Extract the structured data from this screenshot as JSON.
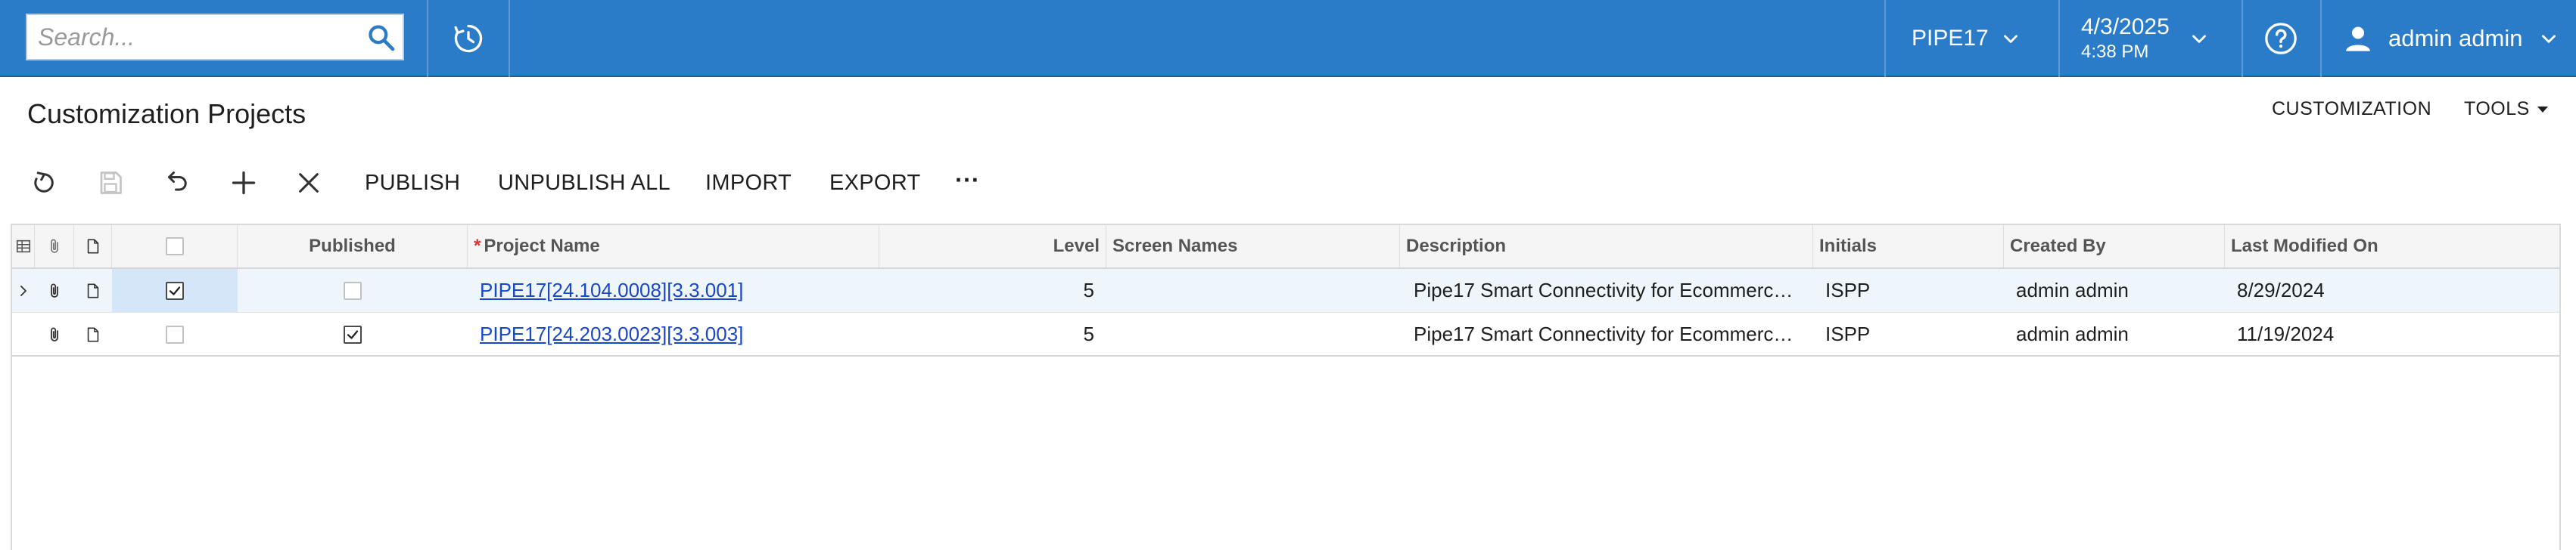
{
  "search": {
    "placeholder": "Search..."
  },
  "topbar": {
    "company": "PIPE17",
    "date": "4/3/2025",
    "time": "4:38 PM",
    "user": "admin admin"
  },
  "page": {
    "title": "Customization Projects",
    "links": {
      "customization": "CUSTOMIZATION",
      "tools": "TOOLS"
    }
  },
  "toolbar": {
    "publish": "PUBLISH",
    "unpublish_all": "UNPUBLISH ALL",
    "import": "IMPORT",
    "export": "EXPORT",
    "more": "···"
  },
  "grid": {
    "columns": {
      "published": "Published",
      "required_mark": "*",
      "project_name": "Project Name",
      "level": "Level",
      "screen_names": "Screen Names",
      "description": "Description",
      "initials": "Initials",
      "created_by": "Created By",
      "last_modified": "Last Modified On"
    },
    "rows": [
      {
        "selected": true,
        "published": false,
        "project_name": "PIPE17[24.104.0008][3.3.001]",
        "level": "5",
        "screen_names": "",
        "description": "Pipe17 Smart Connectivity for Ecommerc…",
        "initials": "ISPP",
        "created_by": "admin admin",
        "last_modified": "8/29/2024"
      },
      {
        "selected": false,
        "published": true,
        "project_name": "PIPE17[24.203.0023][3.3.003]",
        "level": "5",
        "screen_names": "",
        "description": "Pipe17 Smart Connectivity for Ecommerc…",
        "initials": "ISPP",
        "created_by": "admin admin",
        "last_modified": "11/19/2024"
      }
    ]
  },
  "colors": {
    "topbar": "#2a7bc8",
    "link": "#1848c9",
    "selected_row": "#eef5fb"
  }
}
